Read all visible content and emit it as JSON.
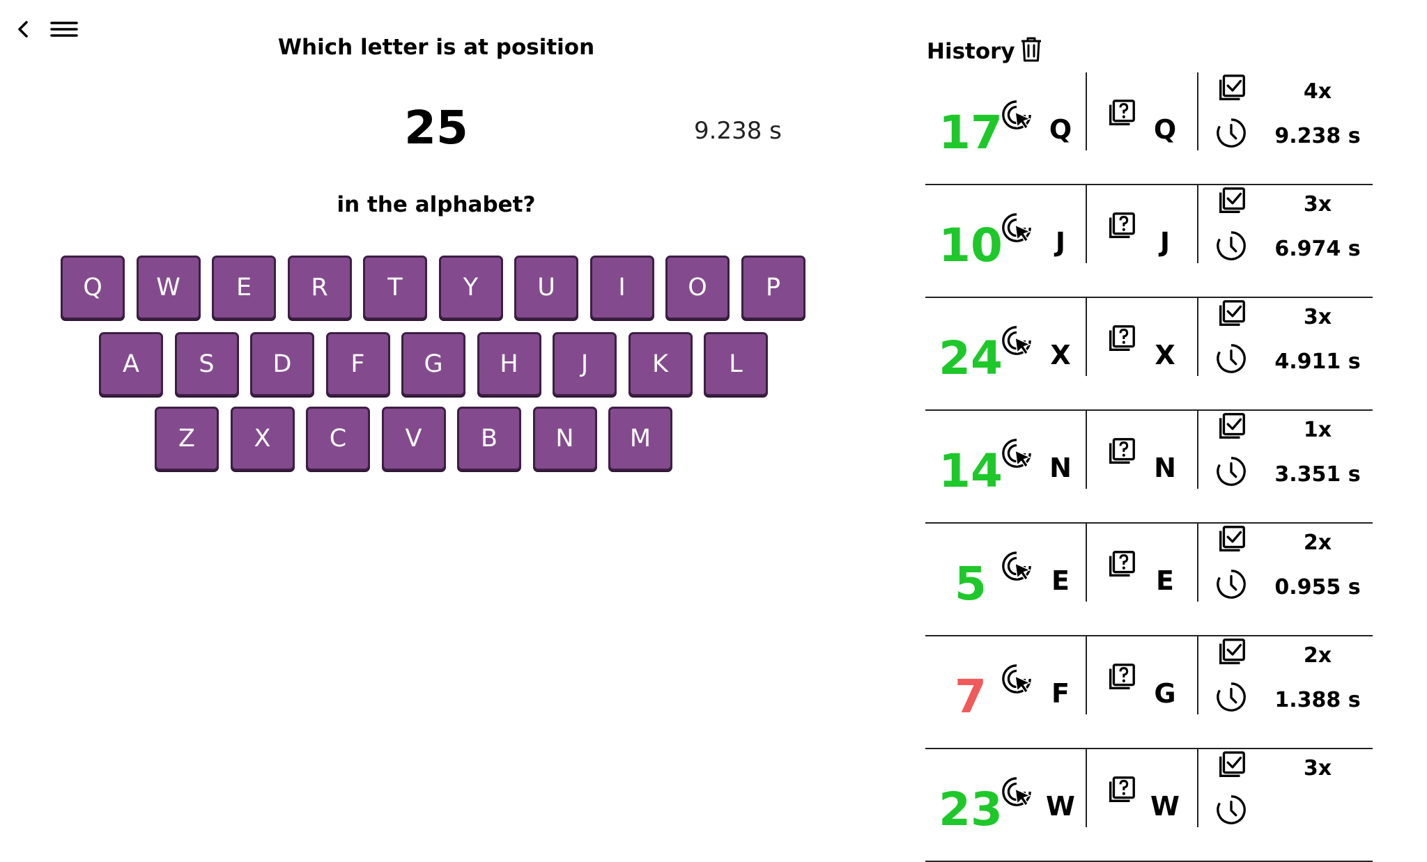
{
  "question": {
    "line1": "Which letter is at position",
    "number": "25",
    "timer": "9.238 s",
    "line2": "in the alphabet?"
  },
  "keyboard": {
    "row1": [
      "Q",
      "W",
      "E",
      "R",
      "T",
      "Y",
      "U",
      "I",
      "O",
      "P"
    ],
    "row2": [
      "A",
      "S",
      "D",
      "F",
      "G",
      "H",
      "J",
      "K",
      "L"
    ],
    "row3": [
      "Z",
      "X",
      "C",
      "V",
      "B",
      "N",
      "M"
    ],
    "key_color": "#834b8d"
  },
  "history": {
    "title": "History",
    "colors": {
      "correct": "#1ec82a",
      "wrong": "#f05a5a"
    },
    "items": [
      {
        "position": "17",
        "chosen": "Q",
        "answer": "Q",
        "attempts": "4x",
        "time": "9.238 s",
        "correct": true
      },
      {
        "position": "10",
        "chosen": "J",
        "answer": "J",
        "attempts": "3x",
        "time": "6.974 s",
        "correct": true
      },
      {
        "position": "24",
        "chosen": "X",
        "answer": "X",
        "attempts": "3x",
        "time": "4.911 s",
        "correct": true
      },
      {
        "position": "14",
        "chosen": "N",
        "answer": "N",
        "attempts": "1x",
        "time": "3.351 s",
        "correct": true
      },
      {
        "position": "5",
        "chosen": "E",
        "answer": "E",
        "attempts": "2x",
        "time": "0.955 s",
        "correct": true
      },
      {
        "position": "7",
        "chosen": "F",
        "answer": "G",
        "attempts": "2x",
        "time": "1.388 s",
        "correct": false
      },
      {
        "position": "23",
        "chosen": "W",
        "answer": "W",
        "attempts": "3x",
        "time": "",
        "correct": true
      }
    ]
  }
}
